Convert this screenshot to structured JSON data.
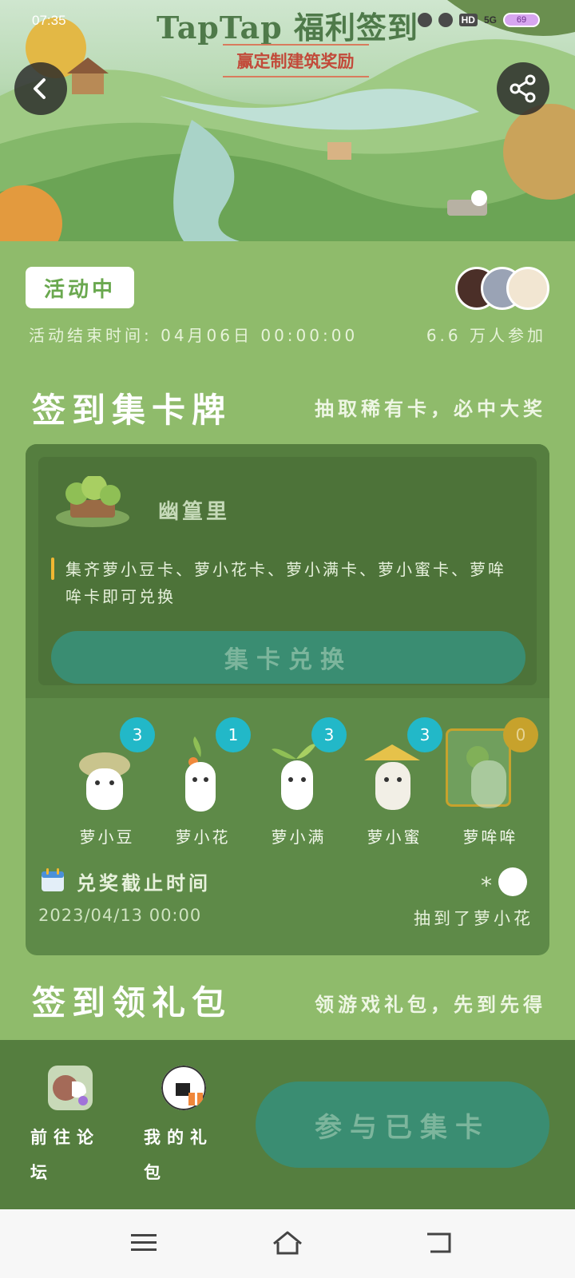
{
  "status_bar": {
    "time": "07:35",
    "network": "5G",
    "battery": "69",
    "hd": "HD"
  },
  "banner": {
    "title": "TapTap 福利签到",
    "subtitle": "赢定制建筑奖励"
  },
  "activity": {
    "status": "活动中",
    "end_time": "活动结束时间: 04月06日 00:00:00",
    "participants": "6.6 万人参加"
  },
  "section_cards": {
    "title": "签到集卡牌",
    "subtitle": "抽取稀有卡，必中大奖"
  },
  "reward": {
    "name": "幽篁里",
    "requirement": "集齐萝小豆卡、萝小花卡、萝小满卡、萝小蜜卡、萝哞哞卡即可兑换",
    "button": "集卡兑换"
  },
  "cards": [
    {
      "name": "萝小豆",
      "count": "3"
    },
    {
      "name": "萝小花",
      "count": "1"
    },
    {
      "name": "萝小满",
      "count": "3"
    },
    {
      "name": "萝小蜜",
      "count": "3"
    },
    {
      "name": "萝哞哞",
      "count": "0"
    }
  ],
  "deadline": {
    "label": "兑奖截止时间",
    "date": "2023/04/13 00:00",
    "drawn_text": "抽到了萝小花"
  },
  "section_gift": {
    "title": "签到领礼包",
    "subtitle": "领游戏礼包，先到先得"
  },
  "bottom_bar": {
    "forum": "前往论坛",
    "gift": "我的礼包",
    "join_button": "参与已集卡"
  },
  "colors": {
    "page_bg": "#8fbb6b",
    "panel": "#5e8a48",
    "accent_teal": "#3a8d72",
    "badge_blue": "#22b8c8",
    "badge_gold": "#c7a22c"
  }
}
